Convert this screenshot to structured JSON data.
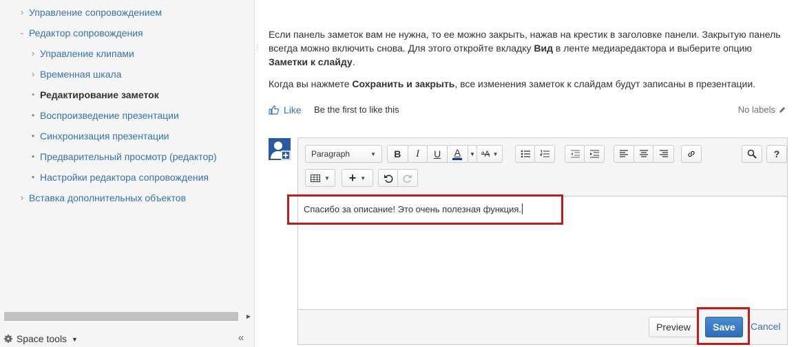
{
  "sidebar": {
    "items": [
      {
        "label": "Управление сопровождением",
        "state": "collapsed"
      },
      {
        "label": "Редактор сопровождения",
        "state": "expanded"
      },
      {
        "label": "Управление клипами",
        "state": "collapsed"
      },
      {
        "label": "Временная шкала",
        "state": "collapsed"
      },
      {
        "label": "Редактирование заметок",
        "state": "current"
      },
      {
        "label": "Воспроизведение презентации",
        "state": "leaf"
      },
      {
        "label": "Синхронизация презентации",
        "state": "leaf"
      },
      {
        "label": "Предварительный просмотр (редактор)",
        "state": "leaf"
      },
      {
        "label": "Настройки редактора сопровождения",
        "state": "leaf"
      },
      {
        "label": "Вставка дополнительных объектов",
        "state": "collapsed"
      }
    ],
    "space_tools_label": "Space tools"
  },
  "content": {
    "para1": {
      "part1": "Если панель заметок вам не нужна, то ее можно закрыть, нажав на крестик в заголовке панели. Закрытую панель всегда можно включить снова. Для этого откройте вкладку ",
      "bold1": "Вид",
      "part2": " в ленте медиаредактора и выберите опцию ",
      "bold2": "Заметки к слайду",
      "part3": "."
    },
    "para2": {
      "part1": "Когда вы нажмете ",
      "bold1": "Сохранить и закрыть",
      "part2": ", все изменения заметок к слайдам будут записаны в презентации."
    },
    "like_label": "Like",
    "like_text": "Be the first to like this",
    "labels_text": "No labels"
  },
  "editor": {
    "paragraph_select": "Paragraph",
    "text": "Спасибо за описание! Это очень полезная функция.",
    "preview_label": "Preview",
    "save_label": "Save",
    "cancel_label": "Cancel"
  },
  "colors": {
    "link": "#3572b0",
    "highlight": "#c11b1b",
    "save_button": "#2f6db8"
  }
}
